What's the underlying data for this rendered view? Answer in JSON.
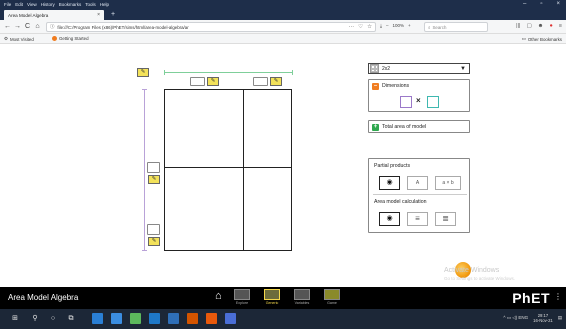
{
  "browser": {
    "menu": [
      "File",
      "Edit",
      "View",
      "History",
      "Bookmarks",
      "Tools",
      "Help"
    ],
    "window_controls": [
      "–",
      "▫",
      "×"
    ],
    "tab": {
      "title": "Area Model Algebra",
      "close": "×",
      "new": "+"
    },
    "nav": {
      "back": "←",
      "forward": "→",
      "reload": "C",
      "home": "⌂"
    },
    "url": "file:///C:/Program Files (x86)/PhET/sims/html/area-model-algebra/ar",
    "url_actions": [
      "···",
      "♡",
      "☆"
    ],
    "zoom": {
      "download": "⤓",
      "minus": "–",
      "level": "100%",
      "plus": "+"
    },
    "search_placeholder": "Search",
    "right_icons": [
      "|||",
      "▢",
      "☻",
      "●",
      "≡"
    ],
    "bookmarks": {
      "most_visited": "Most Visited",
      "getting_started": "Getting Started",
      "other": "Other Bookmarks"
    }
  },
  "sim": {
    "pencil_glyph": "✎",
    "grid_size": {
      "selected": "2x2"
    },
    "dimensions": {
      "label": "Dimensions",
      "toggle": "–",
      "times": "×"
    },
    "total_area": {
      "label": "Total area of model",
      "toggle": "+"
    },
    "partial_products": {
      "label": "Partial products",
      "options": [
        "A",
        "a × b"
      ],
      "eye": "◉"
    },
    "calculation": {
      "label": "Area model calculation",
      "icons": [
        "≡",
        "≣"
      ]
    },
    "watermark": {
      "title": "Activate Windows",
      "subtitle": "Go to Settings to activate Windows."
    }
  },
  "simnav": {
    "title": "Area Model Algebra",
    "screens": [
      {
        "label": "Explore",
        "active": false
      },
      {
        "label": "Generic",
        "active": true
      },
      {
        "label": "Variables",
        "active": false
      },
      {
        "label": "Game",
        "active": false
      }
    ],
    "logo": "PhET",
    "menu": "⋮"
  },
  "taskbar": {
    "clock_time": "29:17",
    "clock_date": "16-Nov-21",
    "tray": "^ ▭ ◁) ENG"
  },
  "colors": {
    "accent_green": "#2fa84f",
    "accent_orange": "#f07c1f",
    "pencil_yellow": "#f3e25a",
    "dim_purple": "#9b79c9",
    "dim_teal": "#3fb8b0"
  }
}
